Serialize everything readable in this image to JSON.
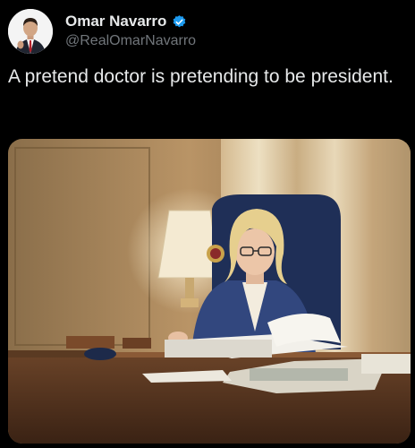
{
  "tweet": {
    "author": {
      "display_name": "Omar Navarro",
      "handle": "@RealOmarNavarro",
      "verified": true
    },
    "text": "A pretend doctor is pretending to be president.",
    "media": {
      "type": "photo"
    }
  },
  "colors": {
    "background": "#000000",
    "text_primary": "#e7e9ea",
    "text_secondary": "#71767b",
    "verified_badge": "#1d9bf0"
  }
}
